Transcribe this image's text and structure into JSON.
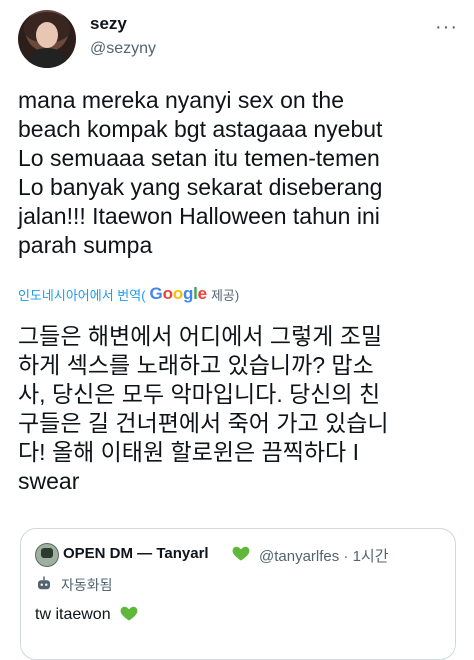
{
  "author": {
    "name": "sezy",
    "handle": "@sezyny"
  },
  "tweet": {
    "text": "mana mereka nyanyi sex on the\nbeach kompak bgt astagaaa nyebut\nLo semuaaa setan itu temen-temen\nLo banyak yang sekarat diseberang\njalan!!! Itaewon Halloween tahun ini\nparah sumpa"
  },
  "translation_bar": {
    "prefix": "인도네시아어에서 번역(",
    "brand": "Google",
    "suffix": " 제공)"
  },
  "translation": {
    "text": "그들은 해변에서 어디에서 그렇게 조밀\n하게 섹스를 노래하고 있습니까? 맙소\n사, 당신은 모두 악마입니다. 당신의 친\n구들은 길 건너편에서 죽어 가고 있습니\n다! 올해 이태원 할로윈은 끔찍하다 I\nswear"
  },
  "quote": {
    "name": "OPEN DM — Tanyarl",
    "handle_time": "@tanyarlfes · 1시간",
    "auto_label": "자동화됨",
    "text": "tw itaewon"
  },
  "icons": {
    "more": "more-horizontal-icon",
    "heart": "green-heart-icon",
    "robot": "automated-bot-icon"
  },
  "colors": {
    "link_blue": "#1d9bf0",
    "heart_green": "#5fb83a",
    "muted": "#536471"
  }
}
